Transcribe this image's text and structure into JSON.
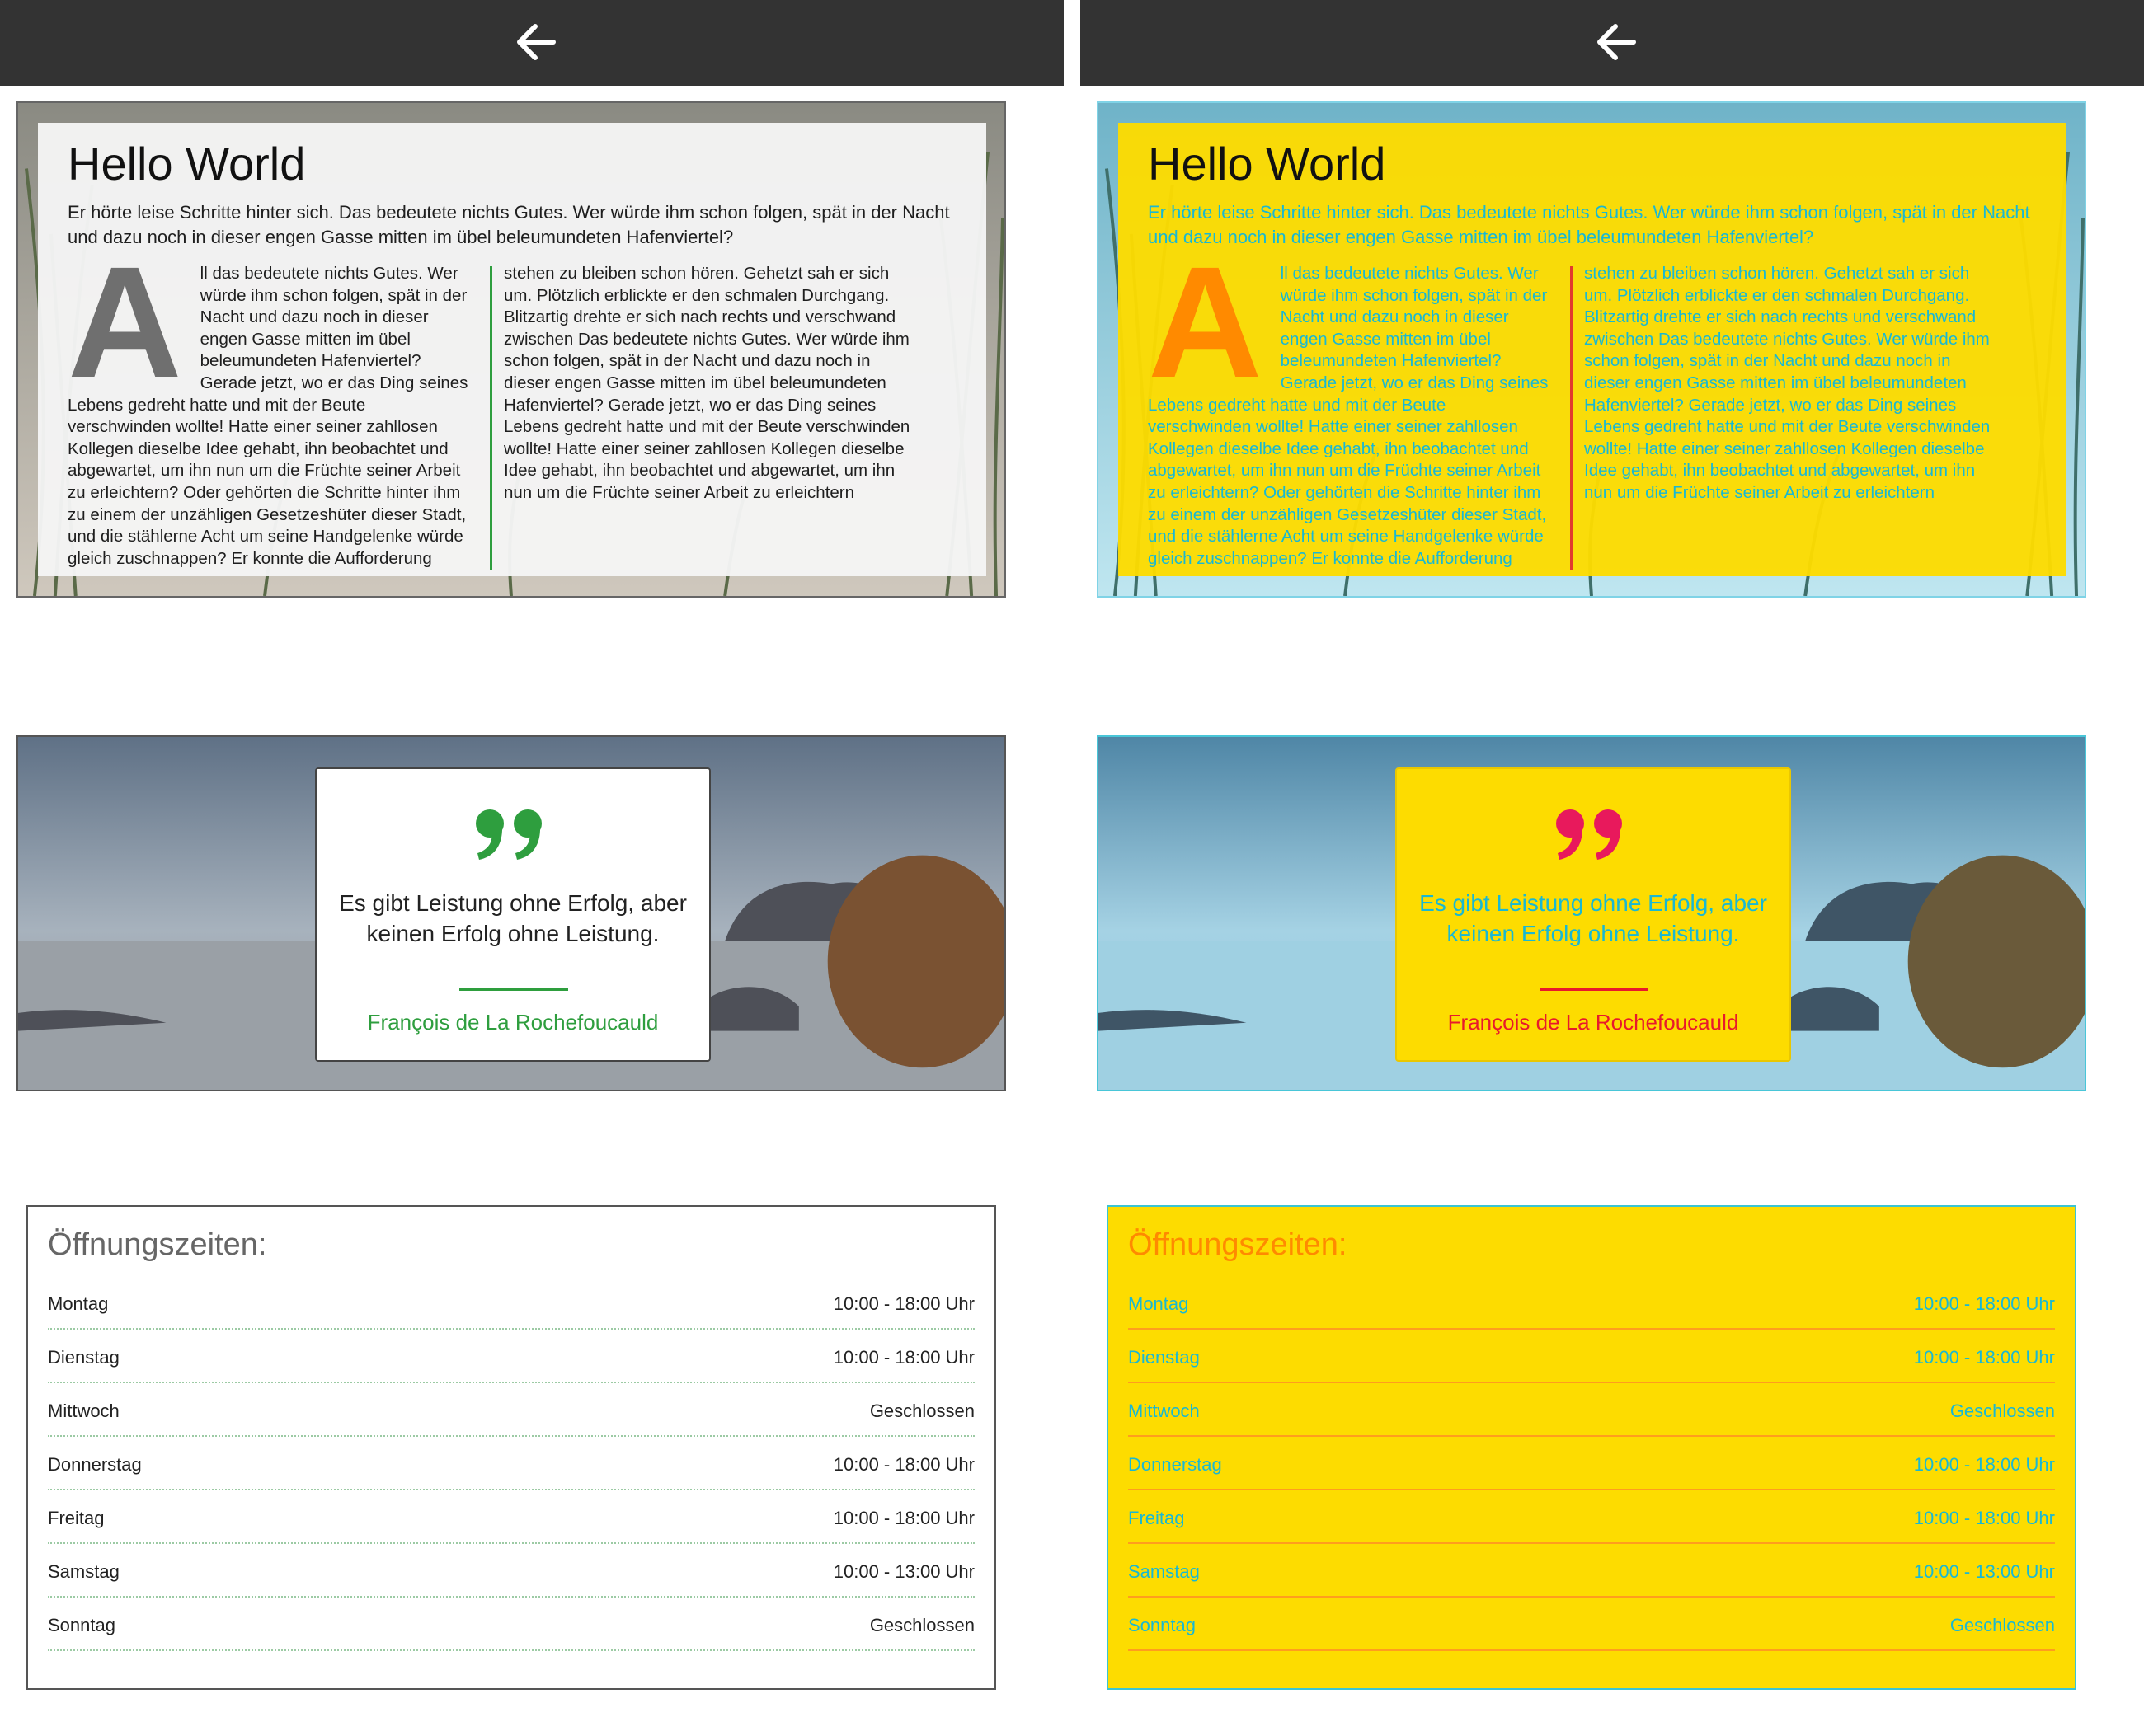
{
  "toolbar": {
    "back_icon": "arrow-left-icon"
  },
  "article": {
    "title": "Hello World",
    "lead": "Er hörte leise Schritte hinter sich. Das bedeutete nichts Gutes. Wer würde ihm schon folgen, spät in der Nacht und dazu noch in dieser engen Gasse mitten im übel beleumundeten Hafenviertel?",
    "dropcap": "A",
    "column_left": "ll das bedeutete nichts Gutes. Wer würde ihm schon folgen, spät in der Nacht und dazu noch in dieser engen Gasse mitten im übel beleumundeten Hafenviertel? Gerade jetzt, wo er das Ding seines Lebens gedreht hatte und mit der Beute verschwinden wollte! Hatte einer seiner zahllosen Kollegen dieselbe Idee gehabt, ihn beobachtet und abgewartet, um ihn nun um die Früchte seiner Arbeit zu erleichtern? Oder gehörten die Schritte hinter ihm zu einem der unzähligen Gesetzeshüter dieser Stadt, und die stählerne Acht um seine Handgelenke würde gleich zuschnappen? Er konnte die Aufforderung",
    "column_right": "stehen zu bleiben schon hören. Gehetzt sah er sich um. Plötzlich erblickte er den schmalen Durchgang. Blitzartig drehte er sich nach rechts und verschwand zwischen  Das bedeutete nichts Gutes. Wer würde ihm schon folgen, spät in der Nacht und dazu noch in dieser engen Gasse mitten im übel beleumundeten Hafenviertel? Gerade jetzt, wo er das Ding seines Lebens gedreht hatte und mit der Beute verschwinden wollte! Hatte einer seiner zahllosen Kollegen dieselbe Idee gehabt, ihn beobachtet und abgewartet, um ihn nun um die Früchte seiner Arbeit zu erleichtern"
  },
  "quote": {
    "icon": "quote-mark-icon",
    "text": "Es gibt Leistung ohne Erfolg, aber keinen Erfolg ohne Leistung.",
    "author": "François de La Rochefoucauld"
  },
  "hours": {
    "title": "Öffnungszeiten:",
    "rows": [
      {
        "day": "Montag",
        "time": "10:00 - 18:00 Uhr"
      },
      {
        "day": "Dienstag",
        "time": "10:00 - 18:00 Uhr"
      },
      {
        "day": "Mittwoch",
        "time": "Geschlossen"
      },
      {
        "day": "Donnerstag",
        "time": "10:00 - 18:00 Uhr"
      },
      {
        "day": "Freitag",
        "time": "10:00 - 18:00 Uhr"
      },
      {
        "day": "Samstag",
        "time": "10:00 - 13:00 Uhr"
      },
      {
        "day": "Sonntag",
        "time": "Geschlossen"
      }
    ]
  },
  "themes": {
    "light": {
      "accent": "#2e9e3e",
      "text": "#1e1e1e",
      "box": "#f5f5f5",
      "dropcap": "#6f6f6f"
    },
    "yellow": {
      "box": "#fddc00",
      "text": "#19b8d3",
      "dropcap": "#ff8a00",
      "accent": "#e8192c",
      "title": "#ff8a00"
    }
  }
}
